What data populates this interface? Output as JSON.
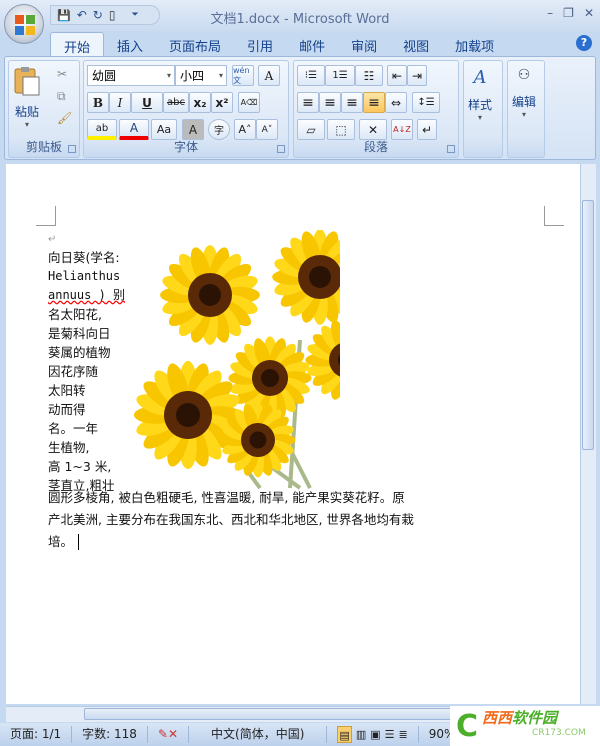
{
  "window": {
    "title": "文档1.docx - Microsoft Word",
    "minimize": "–",
    "restore": "❐",
    "close": "✕"
  },
  "qat": {
    "save": "💾",
    "undo": "↶",
    "redo": "↻",
    "new": "▯",
    "more": "⏷"
  },
  "tabs": [
    "开始",
    "插入",
    "页面布局",
    "引用",
    "邮件",
    "审阅",
    "视图",
    "加载项"
  ],
  "help": "?",
  "clipboard": {
    "paste": "粘贴",
    "label": "剪贴板"
  },
  "font": {
    "name": "幼圆",
    "size": "小四",
    "label": "字体",
    "wen": "wén文",
    "charborder": "A",
    "bold": "B",
    "italic": "I",
    "underline": "U",
    "strike": "abc",
    "sub": "x₂",
    "sup": "x²",
    "clear": "A⌫",
    "highlight": "ab",
    "color": "A",
    "case": "Aa",
    "shade": "A",
    "enclose": "字",
    "grow": "A˄",
    "shrink": "A˅"
  },
  "paragraph": {
    "label": "段落",
    "bullets": "⁝☰",
    "numbering": "1☰",
    "multilevel": "☷",
    "dec_indent": "⇤",
    "inc_indent": "⇥",
    "left": "≡",
    "center": "≡",
    "right": "≡",
    "justify": "≡",
    "distribute": "⇔",
    "spacing": "↕☰",
    "shading": "▱",
    "border": "⬚",
    "asian": "✕",
    "sort": "A↓Z",
    "marks": "↵"
  },
  "styles": {
    "label": "样式"
  },
  "editing": {
    "label": "编辑"
  },
  "document": {
    "narrow_lines": [
      "向日葵(学名:",
      "Helianthus",
      "annuus ) 别",
      "名太阳花,",
      "是菊科向日",
      "葵属的植物",
      "因花序随",
      "太阳转",
      "动而得",
      "名。一年",
      "生植物,",
      "高 1~3 米,",
      "茎直立,粗壮"
    ],
    "wide_lines": [
      "圆形多棱角, 被白色粗硬毛, 性喜温暖, 耐旱, 能产果实葵花籽。原",
      "产北美洲, 主要分布在我国东北、西北和华北地区, 世界各地均有栽",
      "培。"
    ],
    "para_mark": "↵"
  },
  "status": {
    "page": "页面: 1/1",
    "words": "字数: 118",
    "language": "中文(简体，中国)",
    "zoom": "90%"
  },
  "watermark": {
    "brand": "西西软件园",
    "url": "CR173.COM"
  }
}
